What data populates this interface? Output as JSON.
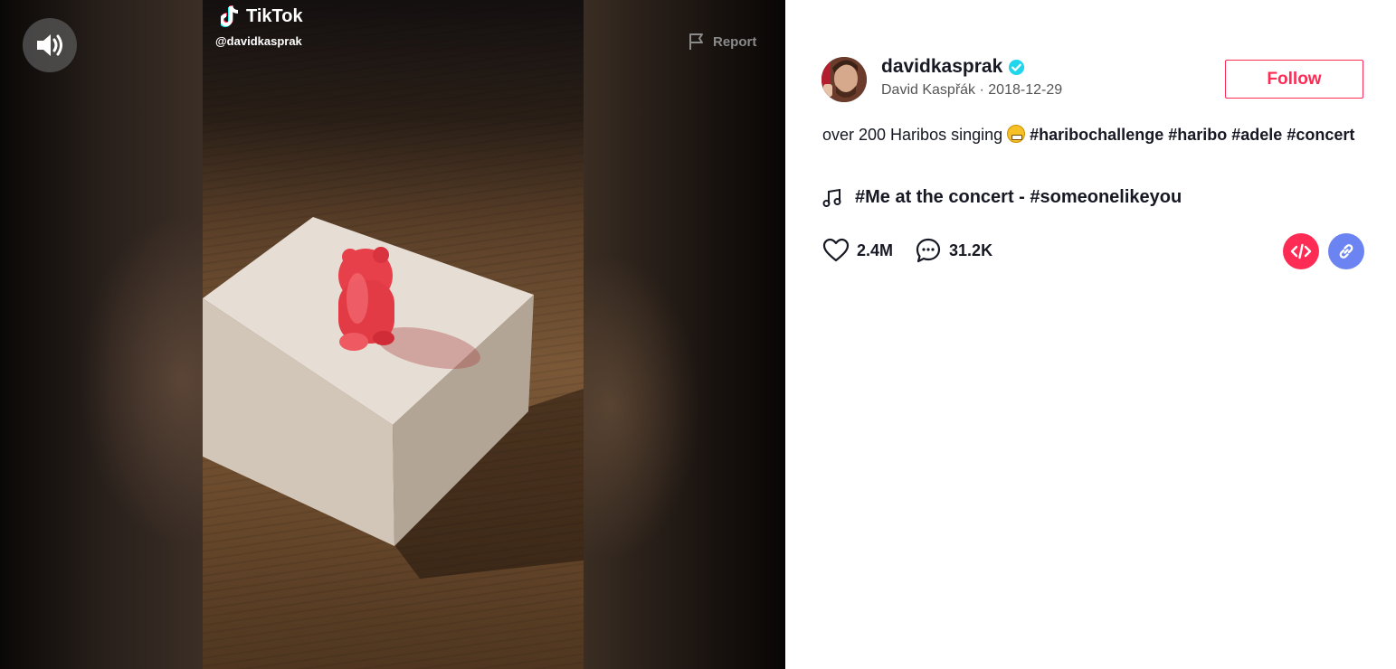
{
  "video": {
    "brand": "TikTok",
    "handle": "@davidkasprak",
    "report_label": "Report",
    "sound_icon": "volume-icon"
  },
  "author": {
    "username": "davidkasprak",
    "verified": true,
    "subline": "David Kaspřák · 2018-12-29"
  },
  "follow_label": "Follow",
  "caption": {
    "text": "over 200 Haribos singing",
    "emoji": "grinning-face-emoji",
    "hashtags": [
      "#haribochallenge",
      "#haribo",
      "#adele",
      "#concert"
    ]
  },
  "music": {
    "title": "#Me at the concert - #someonelikeyou"
  },
  "stats": {
    "likes": "2.4M",
    "comments": "31.2K"
  },
  "colors": {
    "accent": "#fe2c55",
    "link_button": "#6c83f2",
    "verified": "#20d5ec",
    "text": "#161823"
  }
}
